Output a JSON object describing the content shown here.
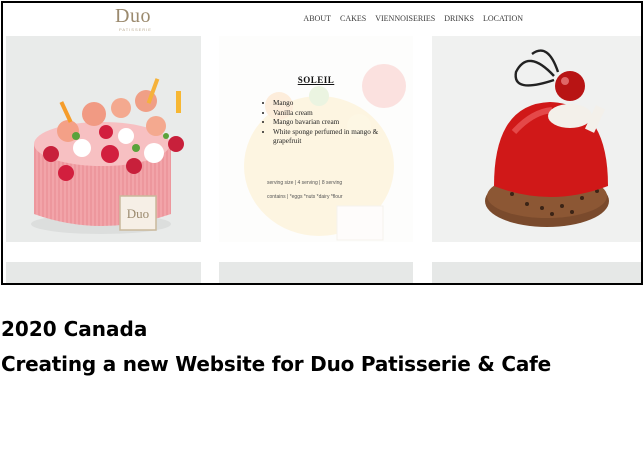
{
  "header": {
    "logo": "Duo",
    "logo_sub": "PATISSERIE",
    "menu": [
      "ABOUT",
      "CAKES",
      "VIENNOISERIES",
      "DRINKS",
      "LOCATION"
    ]
  },
  "cake_tiles": {
    "raspberry_box_label": "Duo",
    "overlay": {
      "title": "SOLEIL",
      "ingredients": [
        "Mango",
        "Vanilla cream",
        "Mango bavarian cream",
        "White sponge perfumed in mango & grapefruit"
      ],
      "serving": "serving size | 4 serving | 8 serving",
      "contains": "contains | *eggs *nuts *dairy *flour"
    }
  },
  "caption": {
    "line1": "2020 Canada",
    "line2": "Creating a new Website for Duo Patisserie & Cafe"
  },
  "colors": {
    "logo": "#9b8a6e",
    "frame_border": "#000000",
    "raspberry_cake": "#ef9aa0",
    "glaze": "#d11a1a"
  }
}
